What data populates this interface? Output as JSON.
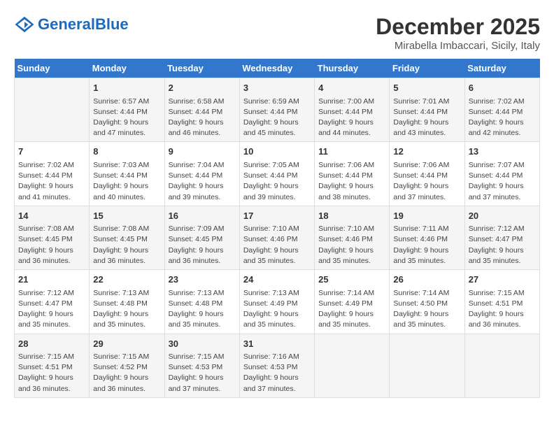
{
  "header": {
    "logo_text_general": "General",
    "logo_text_blue": "Blue",
    "month_year": "December 2025",
    "location": "Mirabella Imbaccari, Sicily, Italy"
  },
  "days_of_week": [
    "Sunday",
    "Monday",
    "Tuesday",
    "Wednesday",
    "Thursday",
    "Friday",
    "Saturday"
  ],
  "weeks": [
    [
      {
        "day": "",
        "sunrise": "",
        "sunset": "",
        "daylight": ""
      },
      {
        "day": "1",
        "sunrise": "Sunrise: 6:57 AM",
        "sunset": "Sunset: 4:44 PM",
        "daylight": "Daylight: 9 hours and 47 minutes."
      },
      {
        "day": "2",
        "sunrise": "Sunrise: 6:58 AM",
        "sunset": "Sunset: 4:44 PM",
        "daylight": "Daylight: 9 hours and 46 minutes."
      },
      {
        "day": "3",
        "sunrise": "Sunrise: 6:59 AM",
        "sunset": "Sunset: 4:44 PM",
        "daylight": "Daylight: 9 hours and 45 minutes."
      },
      {
        "day": "4",
        "sunrise": "Sunrise: 7:00 AM",
        "sunset": "Sunset: 4:44 PM",
        "daylight": "Daylight: 9 hours and 44 minutes."
      },
      {
        "day": "5",
        "sunrise": "Sunrise: 7:01 AM",
        "sunset": "Sunset: 4:44 PM",
        "daylight": "Daylight: 9 hours and 43 minutes."
      },
      {
        "day": "6",
        "sunrise": "Sunrise: 7:02 AM",
        "sunset": "Sunset: 4:44 PM",
        "daylight": "Daylight: 9 hours and 42 minutes."
      }
    ],
    [
      {
        "day": "7",
        "sunrise": "Sunrise: 7:02 AM",
        "sunset": "Sunset: 4:44 PM",
        "daylight": "Daylight: 9 hours and 41 minutes."
      },
      {
        "day": "8",
        "sunrise": "Sunrise: 7:03 AM",
        "sunset": "Sunset: 4:44 PM",
        "daylight": "Daylight: 9 hours and 40 minutes."
      },
      {
        "day": "9",
        "sunrise": "Sunrise: 7:04 AM",
        "sunset": "Sunset: 4:44 PM",
        "daylight": "Daylight: 9 hours and 39 minutes."
      },
      {
        "day": "10",
        "sunrise": "Sunrise: 7:05 AM",
        "sunset": "Sunset: 4:44 PM",
        "daylight": "Daylight: 9 hours and 39 minutes."
      },
      {
        "day": "11",
        "sunrise": "Sunrise: 7:06 AM",
        "sunset": "Sunset: 4:44 PM",
        "daylight": "Daylight: 9 hours and 38 minutes."
      },
      {
        "day": "12",
        "sunrise": "Sunrise: 7:06 AM",
        "sunset": "Sunset: 4:44 PM",
        "daylight": "Daylight: 9 hours and 37 minutes."
      },
      {
        "day": "13",
        "sunrise": "Sunrise: 7:07 AM",
        "sunset": "Sunset: 4:44 PM",
        "daylight": "Daylight: 9 hours and 37 minutes."
      }
    ],
    [
      {
        "day": "14",
        "sunrise": "Sunrise: 7:08 AM",
        "sunset": "Sunset: 4:45 PM",
        "daylight": "Daylight: 9 hours and 36 minutes."
      },
      {
        "day": "15",
        "sunrise": "Sunrise: 7:08 AM",
        "sunset": "Sunset: 4:45 PM",
        "daylight": "Daylight: 9 hours and 36 minutes."
      },
      {
        "day": "16",
        "sunrise": "Sunrise: 7:09 AM",
        "sunset": "Sunset: 4:45 PM",
        "daylight": "Daylight: 9 hours and 36 minutes."
      },
      {
        "day": "17",
        "sunrise": "Sunrise: 7:10 AM",
        "sunset": "Sunset: 4:46 PM",
        "daylight": "Daylight: 9 hours and 35 minutes."
      },
      {
        "day": "18",
        "sunrise": "Sunrise: 7:10 AM",
        "sunset": "Sunset: 4:46 PM",
        "daylight": "Daylight: 9 hours and 35 minutes."
      },
      {
        "day": "19",
        "sunrise": "Sunrise: 7:11 AM",
        "sunset": "Sunset: 4:46 PM",
        "daylight": "Daylight: 9 hours and 35 minutes."
      },
      {
        "day": "20",
        "sunrise": "Sunrise: 7:12 AM",
        "sunset": "Sunset: 4:47 PM",
        "daylight": "Daylight: 9 hours and 35 minutes."
      }
    ],
    [
      {
        "day": "21",
        "sunrise": "Sunrise: 7:12 AM",
        "sunset": "Sunset: 4:47 PM",
        "daylight": "Daylight: 9 hours and 35 minutes."
      },
      {
        "day": "22",
        "sunrise": "Sunrise: 7:13 AM",
        "sunset": "Sunset: 4:48 PM",
        "daylight": "Daylight: 9 hours and 35 minutes."
      },
      {
        "day": "23",
        "sunrise": "Sunrise: 7:13 AM",
        "sunset": "Sunset: 4:48 PM",
        "daylight": "Daylight: 9 hours and 35 minutes."
      },
      {
        "day": "24",
        "sunrise": "Sunrise: 7:13 AM",
        "sunset": "Sunset: 4:49 PM",
        "daylight": "Daylight: 9 hours and 35 minutes."
      },
      {
        "day": "25",
        "sunrise": "Sunrise: 7:14 AM",
        "sunset": "Sunset: 4:49 PM",
        "daylight": "Daylight: 9 hours and 35 minutes."
      },
      {
        "day": "26",
        "sunrise": "Sunrise: 7:14 AM",
        "sunset": "Sunset: 4:50 PM",
        "daylight": "Daylight: 9 hours and 35 minutes."
      },
      {
        "day": "27",
        "sunrise": "Sunrise: 7:15 AM",
        "sunset": "Sunset: 4:51 PM",
        "daylight": "Daylight: 9 hours and 36 minutes."
      }
    ],
    [
      {
        "day": "28",
        "sunrise": "Sunrise: 7:15 AM",
        "sunset": "Sunset: 4:51 PM",
        "daylight": "Daylight: 9 hours and 36 minutes."
      },
      {
        "day": "29",
        "sunrise": "Sunrise: 7:15 AM",
        "sunset": "Sunset: 4:52 PM",
        "daylight": "Daylight: 9 hours and 36 minutes."
      },
      {
        "day": "30",
        "sunrise": "Sunrise: 7:15 AM",
        "sunset": "Sunset: 4:53 PM",
        "daylight": "Daylight: 9 hours and 37 minutes."
      },
      {
        "day": "31",
        "sunrise": "Sunrise: 7:16 AM",
        "sunset": "Sunset: 4:53 PM",
        "daylight": "Daylight: 9 hours and 37 minutes."
      },
      {
        "day": "",
        "sunrise": "",
        "sunset": "",
        "daylight": ""
      },
      {
        "day": "",
        "sunrise": "",
        "sunset": "",
        "daylight": ""
      },
      {
        "day": "",
        "sunrise": "",
        "sunset": "",
        "daylight": ""
      }
    ]
  ]
}
